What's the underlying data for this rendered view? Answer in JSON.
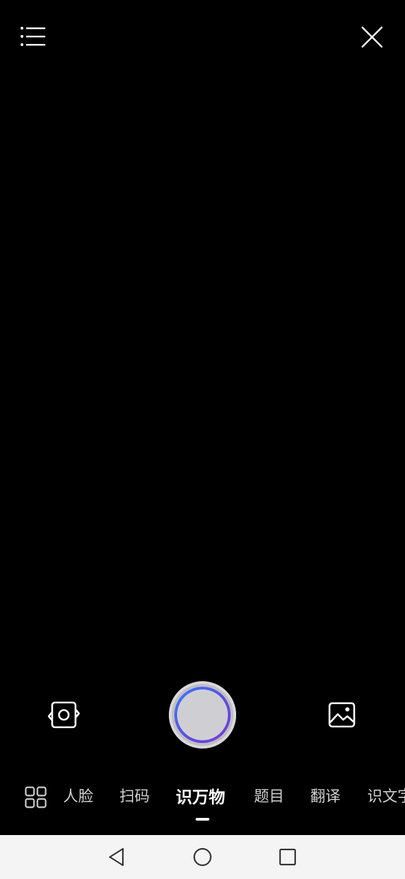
{
  "topbar": {
    "menu_icon": "list-icon",
    "close_icon": "close-icon"
  },
  "controls": {
    "flip_icon": "camera-flip-icon",
    "gallery_icon": "image-icon",
    "shutter_accent_colors": [
      "#3a7bff",
      "#7a3cd6"
    ]
  },
  "modes": {
    "grid_icon": "grid-icon",
    "items": [
      {
        "label": "人脸"
      },
      {
        "label": "扫码"
      },
      {
        "label": "识万物"
      },
      {
        "label": "题目"
      },
      {
        "label": "翻译"
      },
      {
        "label": "识文字"
      }
    ],
    "active_index": 2
  },
  "navbar": {
    "back_icon": "back-triangle-icon",
    "home_icon": "home-circle-icon",
    "recent_icon": "recent-square-icon"
  }
}
